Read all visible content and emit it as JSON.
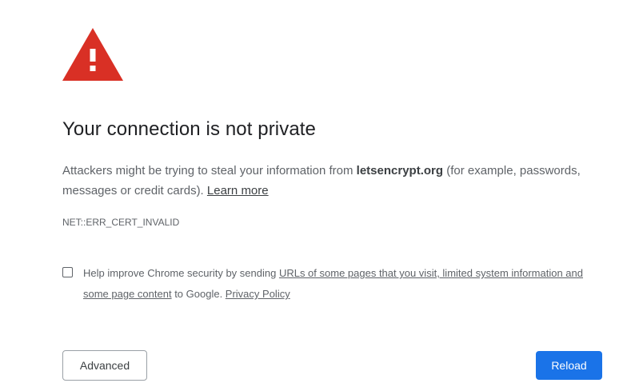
{
  "warning": {
    "icon": "warning-triangle-icon",
    "color": "#d93025"
  },
  "title": "Your connection is not private",
  "description": {
    "part1": "Attackers might be trying to steal your information from ",
    "domain": "letsencrypt.org",
    "part2": " (for example, passwords, messages or credit cards). ",
    "learn_more": "Learn more"
  },
  "error_code": "NET::ERR_CERT_INVALID",
  "optin": {
    "checked": false,
    "part1": "Help improve Chrome security by sending ",
    "link1": "URLs of some pages that you visit, limited system information and some page content",
    "part2": " to Google. ",
    "privacy_link": "Privacy Policy"
  },
  "buttons": {
    "advanced": "Advanced",
    "reload": "Reload"
  },
  "colors": {
    "primary": "#1a73e8",
    "danger": "#d93025",
    "text": "#202124",
    "secondary_text": "#5f6368"
  }
}
